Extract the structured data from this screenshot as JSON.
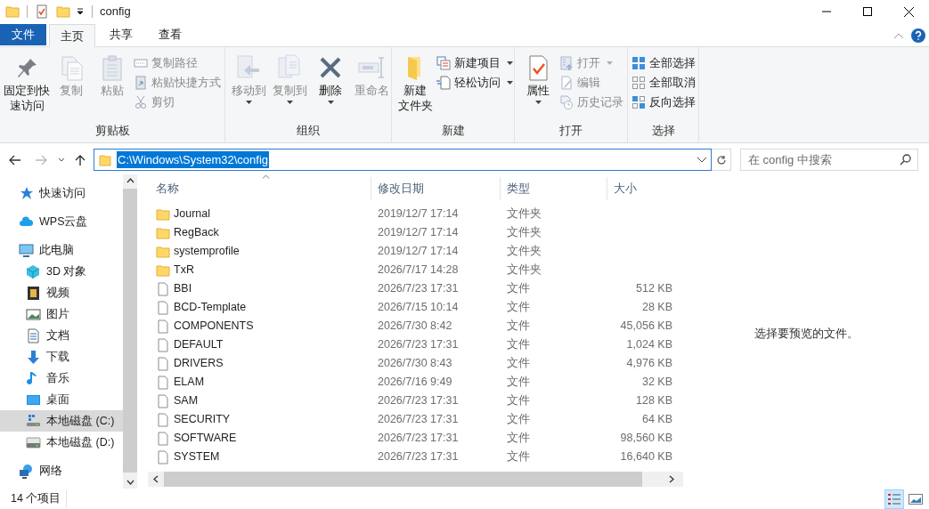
{
  "window": {
    "title": "config"
  },
  "ribbon_tabs": [
    {
      "label": "文件",
      "kind": "file",
      "selected": false
    },
    {
      "label": "主页",
      "kind": "tab",
      "selected": true
    },
    {
      "label": "共享",
      "kind": "tab",
      "selected": false
    },
    {
      "label": "查看",
      "kind": "tab",
      "selected": false
    }
  ],
  "ribbon": {
    "groups": [
      {
        "label": "剪贴板",
        "items": [
          {
            "kind": "large",
            "lines": [
              "固定到快",
              "速访问"
            ],
            "disabled": false,
            "dropdown": false
          },
          {
            "kind": "large",
            "label": "复制",
            "disabled": true,
            "dropdown": false
          },
          {
            "kind": "large",
            "label": "粘贴",
            "disabled": true,
            "dropdown": false
          },
          {
            "kind": "small",
            "label": "复制路径",
            "disabled": true,
            "dropdown": false
          },
          {
            "kind": "small",
            "label": "粘贴快捷方式",
            "disabled": true,
            "dropdown": false
          },
          {
            "kind": "small",
            "label": "剪切",
            "disabled": true,
            "dropdown": false
          }
        ]
      },
      {
        "label": "组织",
        "items": [
          {
            "kind": "large",
            "label": "移动到",
            "disabled": true,
            "dropdown": true
          },
          {
            "kind": "large",
            "label": "复制到",
            "disabled": true,
            "dropdown": true
          },
          {
            "kind": "large",
            "label": "删除",
            "disabled": false,
            "dropdown": true
          },
          {
            "kind": "large",
            "label": "重命名",
            "disabled": true,
            "dropdown": false
          }
        ]
      },
      {
        "label": "新建",
        "items": [
          {
            "kind": "large",
            "lines": [
              "新建",
              "文件夹"
            ],
            "disabled": false,
            "dropdown": false
          },
          {
            "kind": "small",
            "label": "新建项目",
            "disabled": false,
            "dropdown": true
          },
          {
            "kind": "small",
            "label": "轻松访问",
            "disabled": false,
            "dropdown": true
          }
        ]
      },
      {
        "label": "打开",
        "items": [
          {
            "kind": "large",
            "label": "属性",
            "disabled": false,
            "dropdown": true
          },
          {
            "kind": "small",
            "label": "打开",
            "disabled": true,
            "dropdown": true
          },
          {
            "kind": "small",
            "label": "编辑",
            "disabled": true,
            "dropdown": false
          },
          {
            "kind": "small",
            "label": "历史记录",
            "disabled": true,
            "dropdown": false
          }
        ]
      },
      {
        "label": "选择",
        "items": [
          {
            "kind": "small",
            "label": "全部选择",
            "disabled": false,
            "dropdown": false
          },
          {
            "kind": "small",
            "label": "全部取消",
            "disabled": false,
            "dropdown": false
          },
          {
            "kind": "small",
            "label": "反向选择",
            "disabled": false,
            "dropdown": false
          }
        ]
      }
    ]
  },
  "address": {
    "path": "C:\\Windows\\System32\\config",
    "text_selected": true
  },
  "search": {
    "placeholder": "在 config 中搜索"
  },
  "navigation": {
    "items": [
      {
        "label": "快速访问",
        "selected": false
      },
      {
        "label": "WPS云盘",
        "selected": false
      },
      {
        "label": "此电脑",
        "selected": false,
        "children": [
          {
            "label": "3D 对象",
            "selected": false
          },
          {
            "label": "视频",
            "selected": false
          },
          {
            "label": "图片",
            "selected": false
          },
          {
            "label": "文档",
            "selected": false
          },
          {
            "label": "下载",
            "selected": false
          },
          {
            "label": "音乐",
            "selected": false
          },
          {
            "label": "桌面",
            "selected": false
          },
          {
            "label": "本地磁盘 (C:)",
            "selected": true
          },
          {
            "label": "本地磁盘 (D:)",
            "selected": false
          }
        ]
      },
      {
        "label": "网络",
        "selected": false
      }
    ]
  },
  "file_list": {
    "columns": [
      {
        "label": "名称",
        "sorted": true
      },
      {
        "label": "修改日期",
        "sorted": false
      },
      {
        "label": "类型",
        "sorted": false
      },
      {
        "label": "大小",
        "sorted": false
      }
    ],
    "rows": [
      {
        "kind": "folder",
        "name": "Journal",
        "modified": "2019/12/7 17:14",
        "type": "文件夹"
      },
      {
        "kind": "folder",
        "name": "RegBack",
        "modified": "2019/12/7 17:14",
        "type": "文件夹"
      },
      {
        "kind": "folder",
        "name": "systemprofile",
        "modified": "2019/12/7 17:14",
        "type": "文件夹"
      },
      {
        "kind": "folder",
        "name": "TxR",
        "modified": "2026/7/17 14:28",
        "type": "文件夹"
      },
      {
        "kind": "file",
        "name": "BBI",
        "modified": "2026/7/23 17:31",
        "type": "文件",
        "size": "512 KB"
      },
      {
        "kind": "file",
        "name": "BCD-Template",
        "modified": "2026/7/15 10:14",
        "type": "文件",
        "size": "28 KB"
      },
      {
        "kind": "file",
        "name": "COMPONENTS",
        "modified": "2026/7/30 8:42",
        "type": "文件",
        "size": "45,056 KB"
      },
      {
        "kind": "file",
        "name": "DEFAULT",
        "modified": "2026/7/23 17:31",
        "type": "文件",
        "size": "1,024 KB"
      },
      {
        "kind": "file",
        "name": "DRIVERS",
        "modified": "2026/7/30 8:43",
        "type": "文件",
        "size": "4,976 KB"
      },
      {
        "kind": "file",
        "name": "ELAM",
        "modified": "2026/7/16 9:49",
        "type": "文件",
        "size": "32 KB"
      },
      {
        "kind": "file",
        "name": "SAM",
        "modified": "2026/7/23 17:31",
        "type": "文件",
        "size": "128 KB"
      },
      {
        "kind": "file",
        "name": "SECURITY",
        "modified": "2026/7/23 17:31",
        "type": "文件",
        "size": "64 KB"
      },
      {
        "kind": "file",
        "name": "SOFTWARE",
        "modified": "2026/7/23 17:31",
        "type": "文件",
        "size": "98,560 KB"
      },
      {
        "kind": "file",
        "name": "SYSTEM",
        "modified": "2026/7/23 17:31",
        "type": "文件",
        "size": "16,640 KB"
      }
    ]
  },
  "preview": {
    "message": "选择要预览的文件。"
  },
  "status_bar": {
    "item_count": "14 个项目",
    "views": [
      {
        "kind": "details",
        "selected": true
      },
      {
        "kind": "large_icons",
        "selected": false
      }
    ]
  }
}
